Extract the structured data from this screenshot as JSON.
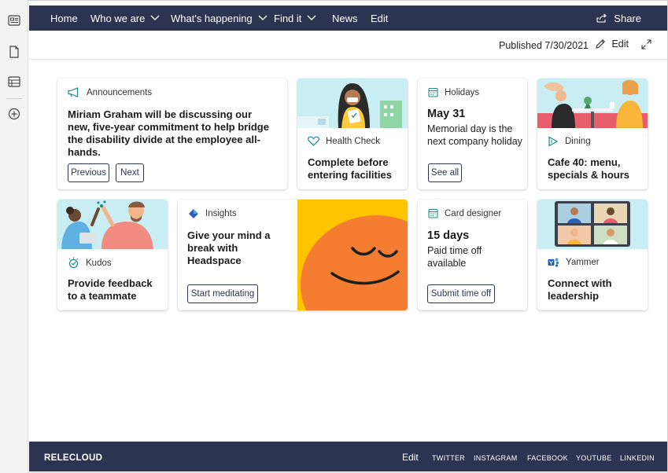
{
  "nav": {
    "items": [
      {
        "label": "Home",
        "dropdown": false
      },
      {
        "label": "Who we are",
        "dropdown": true
      },
      {
        "label": "What's happening",
        "dropdown": true
      },
      {
        "label": "Find it",
        "dropdown": true
      },
      {
        "label": "News",
        "dropdown": false
      },
      {
        "label": "Edit",
        "dropdown": false
      }
    ],
    "share_label": "Share"
  },
  "command_bar": {
    "published": "Published 7/30/2021",
    "edit_label": "Edit"
  },
  "cards": {
    "announcements": {
      "label": "Announcements",
      "text": "Miriam Graham will be discussing our new, five-year commitment to help bridge the disability divide at the employee all-hands.",
      "prev_label": "Previous",
      "next_label": "Next"
    },
    "health": {
      "label": "Health Check",
      "title": "Complete before entering facilities"
    },
    "holidays": {
      "label": "Holidays",
      "date": "May 31",
      "text": "Memorial day is the next company holiday",
      "button": "See all"
    },
    "dining": {
      "label": "Dining",
      "title": "Cafe 40: menu, specials & hours"
    },
    "kudos": {
      "label": "Kudos",
      "title": "Provide feedback to a teammate"
    },
    "insights": {
      "label": "Insights",
      "title": "Give your mind a break with Headspace",
      "button": "Start meditating"
    },
    "card_designer": {
      "label": "Card designer",
      "big": "15 days",
      "text": "Paid time off available",
      "button": "Submit time off"
    },
    "yammer": {
      "label": "Yammer",
      "title": "Connect with leadership"
    }
  },
  "footer": {
    "brand": "RELECLOUD",
    "edit_label": "Edit",
    "links": [
      "TWITTER",
      "INSTAGRAM",
      "FACEBOOK",
      "YOUTUBE",
      "LINKEDIN"
    ]
  },
  "colors": {
    "nav_bg": "#2b3551",
    "accent_teal": "#1b8a8a",
    "headspace_orange": "#f47d31",
    "headspace_yellow": "#ffc400"
  },
  "icons": [
    "news-icon",
    "page-icon",
    "list-icon",
    "add-icon",
    "share-icon",
    "pencil-icon",
    "expand-icon",
    "megaphone-icon",
    "heart-icon",
    "calendar-icon",
    "dining-icon",
    "kudos-icon",
    "insights-icon",
    "yammer-icon"
  ]
}
